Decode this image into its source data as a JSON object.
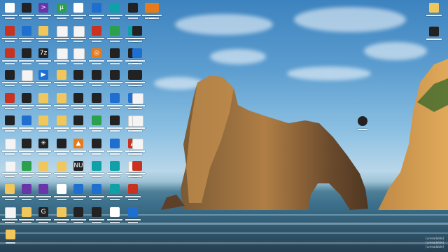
{
  "window": {
    "title": "Windows desktop"
  },
  "desktop": {
    "wallpaper": "rock arch over sea at sunset",
    "icons_col1": [
      {
        "name": "chrome-beta-icon",
        "glyph": "",
        "cls": "g-white"
      },
      {
        "name": "red-app-icon",
        "glyph": "",
        "cls": "g-red"
      },
      {
        "name": "red-app-2-icon",
        "glyph": "",
        "cls": "g-red"
      },
      {
        "name": "dark-app-icon",
        "glyph": "",
        "cls": "g-dark"
      },
      {
        "name": "redblack-app-icon",
        "glyph": "",
        "cls": "g-red"
      },
      {
        "name": "black-icon",
        "glyph": "",
        "cls": "g-dark"
      },
      {
        "name": "document-icon",
        "glyph": "",
        "cls": "g-doc"
      },
      {
        "name": "document-2-icon",
        "glyph": "",
        "cls": "g-doc"
      },
      {
        "name": "folder-icon",
        "glyph": "",
        "cls": "g-folder"
      },
      {
        "name": "document-3-icon",
        "glyph": "",
        "cls": "g-doc"
      }
    ],
    "icons_col2": [
      {
        "name": "snake-app-icon",
        "glyph": "",
        "cls": "g-dark"
      },
      {
        "name": "monitor-app-icon",
        "glyph": "",
        "cls": "g-blue"
      },
      {
        "name": "badge-app-icon",
        "glyph": "",
        "cls": "g-dark"
      },
      {
        "name": "document-4-icon",
        "glyph": "",
        "cls": "g-doc"
      },
      {
        "name": "dark-app-2-icon",
        "glyph": "",
        "cls": "g-dark"
      },
      {
        "name": "blue-folder-icon",
        "glyph": "",
        "cls": "g-blue"
      },
      {
        "name": "black-app-icon",
        "glyph": "",
        "cls": "g-dark"
      },
      {
        "name": "green-app-icon",
        "glyph": "",
        "cls": "g-green"
      },
      {
        "name": "purple-app-icon",
        "glyph": "",
        "cls": "g-purple"
      },
      {
        "name": "folder-2-icon",
        "glyph": "",
        "cls": "g-folder"
      }
    ],
    "icons_col3": [
      {
        "name": "terminal-icon",
        "glyph": ">",
        "cls": "g-purple"
      },
      {
        "name": "folder-3-icon",
        "glyph": "",
        "cls": "g-folder"
      },
      {
        "name": "zip-icon",
        "glyph": "7z",
        "cls": "g-dark"
      },
      {
        "name": "play-icon",
        "glyph": "▶",
        "cls": "g-blue"
      },
      {
        "name": "folder-4-icon",
        "glyph": "",
        "cls": "g-folder"
      },
      {
        "name": "folder-5-icon",
        "glyph": "",
        "cls": "g-folder"
      },
      {
        "name": "gear-icon",
        "glyph": "✳",
        "cls": "g-dark"
      },
      {
        "name": "folder-6-icon",
        "glyph": "",
        "cls": "g-folder"
      },
      {
        "name": "dark-folder-icon",
        "glyph": "",
        "cls": "g-purple"
      },
      {
        "name": "green-app-2-icon",
        "glyph": "G",
        "cls": "g-dark"
      }
    ],
    "icons_col4": [
      {
        "name": "torrent-icon",
        "glyph": "µ",
        "cls": "g-green"
      },
      {
        "name": "document-5-icon",
        "glyph": "",
        "cls": "g-doc"
      },
      {
        "name": "document-6-icon",
        "glyph": "",
        "cls": "g-doc"
      },
      {
        "name": "folder-7-icon",
        "glyph": "",
        "cls": "g-folder"
      },
      {
        "name": "folder-8-icon",
        "glyph": "",
        "cls": "g-folder"
      },
      {
        "name": "folder-9-icon",
        "glyph": "",
        "cls": "g-folder"
      },
      {
        "name": "grid-icon",
        "glyph": "",
        "cls": "g-dark"
      },
      {
        "name": "folder-10-icon",
        "glyph": "",
        "cls": "g-folder"
      },
      {
        "name": "app-icon",
        "glyph": "",
        "cls": "g-white"
      },
      {
        "name": "folder-11-icon",
        "glyph": "",
        "cls": "g-folder"
      }
    ],
    "icons_col5": [
      {
        "name": "app-2-icon",
        "glyph": "",
        "cls": "g-white"
      },
      {
        "name": "notepad-icon",
        "glyph": "",
        "cls": "g-doc"
      },
      {
        "name": "document-7-icon",
        "glyph": "",
        "cls": "g-doc"
      },
      {
        "name": "app-3-icon",
        "glyph": "",
        "cls": "g-dark"
      },
      {
        "name": "app-4-icon",
        "glyph": "",
        "cls": "g-dark"
      },
      {
        "name": "app-5-icon",
        "glyph": "",
        "cls": "g-dark"
      },
      {
        "name": "vlc-icon",
        "glyph": "▲",
        "cls": "g-orange"
      },
      {
        "name": "nu-icon",
        "glyph": "NU",
        "cls": "g-dark"
      },
      {
        "name": "steam-icon",
        "glyph": "",
        "cls": "g-blue"
      },
      {
        "name": "app-6-icon",
        "glyph": "",
        "cls": "g-dark"
      }
    ],
    "icons_col6": [
      {
        "name": "app-7-icon",
        "glyph": "",
        "cls": "g-blue"
      },
      {
        "name": "app-8-icon",
        "glyph": "",
        "cls": "g-red"
      },
      {
        "name": "target-icon",
        "glyph": "◎",
        "cls": "g-orange"
      },
      {
        "name": "app-9-icon",
        "glyph": "",
        "cls": "g-dark"
      },
      {
        "name": "app-10-icon",
        "glyph": "",
        "cls": "g-dark"
      },
      {
        "name": "app-11-icon",
        "glyph": "",
        "cls": "g-green"
      },
      {
        "name": "app-12-icon",
        "glyph": "",
        "cls": "g-dark"
      },
      {
        "name": "app-13-icon",
        "glyph": "",
        "cls": "g-teal"
      },
      {
        "name": "steam-2-icon",
        "glyph": "",
        "cls": "g-blue"
      },
      {
        "name": "app-14-icon",
        "glyph": "",
        "cls": "g-dark"
      }
    ],
    "icons_col7": [
      {
        "name": "app-15-icon",
        "glyph": "",
        "cls": "g-teal"
      },
      {
        "name": "app-16-icon",
        "glyph": "",
        "cls": "g-green"
      },
      {
        "name": "app-17-icon",
        "glyph": "",
        "cls": "g-dark"
      },
      {
        "name": "app-18-icon",
        "glyph": "",
        "cls": "g-dark"
      },
      {
        "name": "app-19-icon",
        "glyph": "",
        "cls": "g-blue"
      },
      {
        "name": "app-20-icon",
        "glyph": "",
        "cls": "g-dark"
      },
      {
        "name": "app-21-icon",
        "glyph": "",
        "cls": "g-blue"
      },
      {
        "name": "app-22-icon",
        "glyph": "",
        "cls": "g-teal"
      },
      {
        "name": "steam-3-icon",
        "glyph": "",
        "cls": "g-teal"
      },
      {
        "name": "chrome-icon",
        "glyph": "",
        "cls": "g-white"
      }
    ],
    "icons_col8": [
      {
        "name": "app-23-icon",
        "glyph": "",
        "cls": "g-dark"
      },
      {
        "name": "app-24-icon",
        "glyph": "",
        "cls": "g-teal"
      },
      {
        "name": "app-25-icon",
        "glyph": "",
        "cls": "g-dark"
      },
      {
        "name": "app-26-icon",
        "glyph": "",
        "cls": "g-dark"
      },
      {
        "name": "app-27-icon",
        "glyph": "",
        "cls": "g-blue"
      },
      {
        "name": "document-8-icon",
        "glyph": "",
        "cls": "g-doc"
      },
      {
        "name": "delta-icon",
        "glyph": "▲",
        "cls": "g-red"
      },
      {
        "name": "document-9-icon",
        "glyph": "",
        "cls": "g-doc"
      },
      {
        "name": "app-28-icon",
        "glyph": "",
        "cls": "g-red"
      },
      {
        "name": "app-29-icon",
        "glyph": "",
        "cls": "g-blue"
      }
    ],
    "icons_col9": [
      {
        "name": "photoshop-icon",
        "glyph": "",
        "cls": "g-orange"
      },
      {
        "name": "app-30-icon",
        "glyph": "",
        "cls": "g-dark"
      },
      {
        "name": "app-31-icon",
        "glyph": "",
        "cls": "g-blue"
      },
      {
        "name": "app-32-icon",
        "glyph": "",
        "cls": "g-dark"
      },
      {
        "name": "document-10-icon",
        "glyph": "",
        "cls": "g-doc"
      },
      {
        "name": "document-11-icon",
        "glyph": "",
        "cls": "g-doc"
      },
      {
        "name": "document-12-icon",
        "glyph": "",
        "cls": "g-doc"
      },
      {
        "name": "app-33-icon",
        "glyph": "",
        "cls": "g-red"
      }
    ],
    "icons_col10": [
      {
        "name": "app-34-icon",
        "glyph": "",
        "cls": "g-orange"
      }
    ],
    "right_icons": [
      {
        "name": "right-folder-icon",
        "glyph": "",
        "cls": "g-folder"
      },
      {
        "name": "this-pc-icon",
        "glyph": "",
        "cls": "g-blue"
      },
      {
        "name": "xbox-icon",
        "glyph": "",
        "cls": "g-dark"
      }
    ],
    "bottom_left_icon": {
      "name": "bottom-folder-icon",
      "glyph": "",
      "cls": "g-folder"
    }
  },
  "watermark": {
    "line1": "[unreadable]",
    "line2": "[unreadable]",
    "line3": "[unreadable]"
  }
}
